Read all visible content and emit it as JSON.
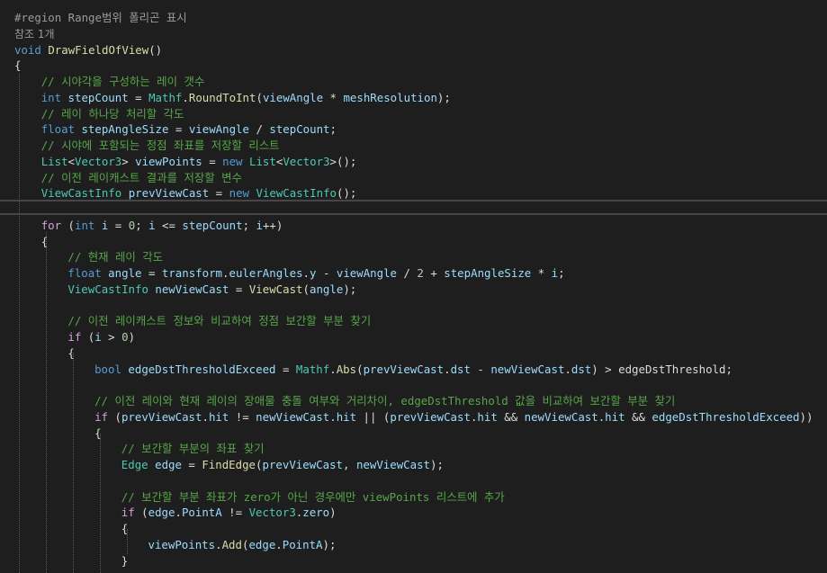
{
  "editor": {
    "theme_colors": {
      "background": "#1e1e1e",
      "keyword": "#569cd6",
      "control_keyword": "#d8a0df",
      "type": "#4ec9b0",
      "method": "#dcdcaa",
      "identifier": "#9cdcfe",
      "comment": "#57a64a",
      "number": "#b5cea8"
    },
    "lines": [
      {
        "tokens": [
          {
            "c": "pp",
            "t": "#region Range범위 폴리곤 표시"
          }
        ]
      },
      {
        "codelens": "참조 1개"
      },
      {
        "tokens": [
          {
            "c": "kw",
            "t": "void"
          },
          {
            "c": "txt",
            "t": " "
          },
          {
            "c": "method",
            "t": "DrawFieldOfView"
          },
          {
            "c": "txt",
            "t": "()"
          }
        ]
      },
      {
        "tokens": [
          {
            "c": "txt",
            "t": "{"
          }
        ]
      },
      {
        "indent": 1,
        "tokens": [
          {
            "c": "cm",
            "t": "// 시야각을 구성하는 레이 갯수"
          }
        ]
      },
      {
        "indent": 1,
        "tokens": [
          {
            "c": "kw",
            "t": "int"
          },
          {
            "c": "txt",
            "t": " "
          },
          {
            "c": "local",
            "t": "stepCount"
          },
          {
            "c": "txt",
            "t": " = "
          },
          {
            "c": "type",
            "t": "Mathf"
          },
          {
            "c": "txt",
            "t": "."
          },
          {
            "c": "method",
            "t": "RoundToInt"
          },
          {
            "c": "txt",
            "t": "("
          },
          {
            "c": "prop",
            "t": "viewAngle"
          },
          {
            "c": "txt",
            "t": " * "
          },
          {
            "c": "prop",
            "t": "meshResolution"
          },
          {
            "c": "txt",
            "t": ");"
          }
        ]
      },
      {
        "indent": 1,
        "tokens": [
          {
            "c": "cm",
            "t": "// 레이 하나당 처리할 각도"
          }
        ]
      },
      {
        "indent": 1,
        "tokens": [
          {
            "c": "kw",
            "t": "float"
          },
          {
            "c": "txt",
            "t": " "
          },
          {
            "c": "local",
            "t": "stepAngleSize"
          },
          {
            "c": "txt",
            "t": " = "
          },
          {
            "c": "prop",
            "t": "viewAngle"
          },
          {
            "c": "txt",
            "t": " / "
          },
          {
            "c": "local",
            "t": "stepCount"
          },
          {
            "c": "txt",
            "t": ";"
          }
        ]
      },
      {
        "indent": 1,
        "tokens": [
          {
            "c": "cm",
            "t": "// 시야에 포함되는 정점 좌표를 저장할 리스트"
          }
        ]
      },
      {
        "indent": 1,
        "tokens": [
          {
            "c": "type",
            "t": "List"
          },
          {
            "c": "txt",
            "t": "<"
          },
          {
            "c": "type",
            "t": "Vector3"
          },
          {
            "c": "txt",
            "t": "> "
          },
          {
            "c": "local",
            "t": "viewPoints"
          },
          {
            "c": "txt",
            "t": " = "
          },
          {
            "c": "kw",
            "t": "new"
          },
          {
            "c": "txt",
            "t": " "
          },
          {
            "c": "type",
            "t": "List"
          },
          {
            "c": "txt",
            "t": "<"
          },
          {
            "c": "type",
            "t": "Vector3"
          },
          {
            "c": "txt",
            "t": ">();"
          }
        ]
      },
      {
        "indent": 1,
        "tokens": [
          {
            "c": "cm",
            "t": "// 이전 레이캐스트 결과를 저장할 변수"
          }
        ]
      },
      {
        "indent": 1,
        "tokens": [
          {
            "c": "type",
            "t": "ViewCastInfo"
          },
          {
            "c": "txt",
            "t": " "
          },
          {
            "c": "local",
            "t": "prevViewCast"
          },
          {
            "c": "txt",
            "t": " = "
          },
          {
            "c": "kw",
            "t": "new"
          },
          {
            "c": "txt",
            "t": " "
          },
          {
            "c": "type",
            "t": "ViewCastInfo"
          },
          {
            "c": "txt",
            "t": "();"
          }
        ]
      },
      {
        "tokens": []
      },
      {
        "indent": 1,
        "tokens": [
          {
            "c": "kw2",
            "t": "for"
          },
          {
            "c": "txt",
            "t": " ("
          },
          {
            "c": "kw",
            "t": "int"
          },
          {
            "c": "txt",
            "t": " "
          },
          {
            "c": "local",
            "t": "i"
          },
          {
            "c": "txt",
            "t": " = "
          },
          {
            "c": "num",
            "t": "0"
          },
          {
            "c": "txt",
            "t": "; "
          },
          {
            "c": "local",
            "t": "i"
          },
          {
            "c": "txt",
            "t": " <= "
          },
          {
            "c": "local",
            "t": "stepCount"
          },
          {
            "c": "txt",
            "t": "; "
          },
          {
            "c": "local",
            "t": "i"
          },
          {
            "c": "txt",
            "t": "++)"
          }
        ]
      },
      {
        "indent": 1,
        "tokens": [
          {
            "c": "txt",
            "t": "{"
          }
        ]
      },
      {
        "indent": 2,
        "tokens": [
          {
            "c": "cm",
            "t": "// 현재 레이 각도"
          }
        ]
      },
      {
        "indent": 2,
        "tokens": [
          {
            "c": "kw",
            "t": "float"
          },
          {
            "c": "txt",
            "t": " "
          },
          {
            "c": "local",
            "t": "angle"
          },
          {
            "c": "txt",
            "t": " = "
          },
          {
            "c": "prop",
            "t": "transform"
          },
          {
            "c": "txt",
            "t": "."
          },
          {
            "c": "prop",
            "t": "eulerAngles"
          },
          {
            "c": "txt",
            "t": "."
          },
          {
            "c": "prop",
            "t": "y"
          },
          {
            "c": "txt",
            "t": " - "
          },
          {
            "c": "prop",
            "t": "viewAngle"
          },
          {
            "c": "txt",
            "t": " / "
          },
          {
            "c": "num",
            "t": "2"
          },
          {
            "c": "txt",
            "t": " + "
          },
          {
            "c": "local",
            "t": "stepAngleSize"
          },
          {
            "c": "txt",
            "t": " * "
          },
          {
            "c": "local",
            "t": "i"
          },
          {
            "c": "txt",
            "t": ";"
          }
        ]
      },
      {
        "indent": 2,
        "tokens": [
          {
            "c": "type",
            "t": "ViewCastInfo"
          },
          {
            "c": "txt",
            "t": " "
          },
          {
            "c": "local",
            "t": "newViewCast"
          },
          {
            "c": "txt",
            "t": " = "
          },
          {
            "c": "method",
            "t": "ViewCast"
          },
          {
            "c": "txt",
            "t": "("
          },
          {
            "c": "local",
            "t": "angle"
          },
          {
            "c": "txt",
            "t": ");"
          }
        ]
      },
      {
        "tokens": []
      },
      {
        "indent": 2,
        "tokens": [
          {
            "c": "cm",
            "t": "// 이전 레이캐스트 정보와 비교하여 정점 보간할 부분 찾기"
          }
        ]
      },
      {
        "indent": 2,
        "tokens": [
          {
            "c": "kw2",
            "t": "if"
          },
          {
            "c": "txt",
            "t": " ("
          },
          {
            "c": "local",
            "t": "i"
          },
          {
            "c": "txt",
            "t": " > "
          },
          {
            "c": "num",
            "t": "0"
          },
          {
            "c": "txt",
            "t": ")"
          }
        ]
      },
      {
        "indent": 2,
        "tokens": [
          {
            "c": "txt",
            "t": "{"
          }
        ]
      },
      {
        "indent": 3,
        "tokens": [
          {
            "c": "kw",
            "t": "bool"
          },
          {
            "c": "txt",
            "t": " "
          },
          {
            "c": "local",
            "t": "edgeDstThresholdExceed"
          },
          {
            "c": "txt",
            "t": " = "
          },
          {
            "c": "type",
            "t": "Mathf"
          },
          {
            "c": "txt",
            "t": "."
          },
          {
            "c": "method",
            "t": "Abs"
          },
          {
            "c": "txt",
            "t": "("
          },
          {
            "c": "local",
            "t": "prevViewCast"
          },
          {
            "c": "txt",
            "t": "."
          },
          {
            "c": "prop",
            "t": "dst"
          },
          {
            "c": "txt",
            "t": " - "
          },
          {
            "c": "local",
            "t": "newViewCast"
          },
          {
            "c": "txt",
            "t": "."
          },
          {
            "c": "prop",
            "t": "dst"
          },
          {
            "c": "txt",
            "t": ") > "
          },
          {
            "c": "txt",
            "t": "edgeDstThreshold"
          },
          {
            "c": "txt",
            "t": ";"
          }
        ]
      },
      {
        "tokens": []
      },
      {
        "indent": 3,
        "tokens": [
          {
            "c": "cm",
            "t": "// 이전 레이와 현재 레이의 장애물 충돌 여부와 거리차이, edgeDstThreshold 값을 비교하여 보간할 부분 찾기"
          }
        ]
      },
      {
        "indent": 3,
        "tokens": [
          {
            "c": "kw2",
            "t": "if"
          },
          {
            "c": "txt",
            "t": " ("
          },
          {
            "c": "local",
            "t": "prevViewCast"
          },
          {
            "c": "txt",
            "t": "."
          },
          {
            "c": "prop",
            "t": "hit"
          },
          {
            "c": "txt",
            "t": " != "
          },
          {
            "c": "local",
            "t": "newViewCast"
          },
          {
            "c": "txt",
            "t": "."
          },
          {
            "c": "prop",
            "t": "hit"
          },
          {
            "c": "txt",
            "t": " || ("
          },
          {
            "c": "local",
            "t": "prevViewCast"
          },
          {
            "c": "txt",
            "t": "."
          },
          {
            "c": "prop",
            "t": "hit"
          },
          {
            "c": "txt",
            "t": " && "
          },
          {
            "c": "local",
            "t": "newViewCast"
          },
          {
            "c": "txt",
            "t": "."
          },
          {
            "c": "prop",
            "t": "hit"
          },
          {
            "c": "txt",
            "t": " && "
          },
          {
            "c": "local",
            "t": "edgeDstThresholdExceed"
          },
          {
            "c": "txt",
            "t": "))"
          }
        ]
      },
      {
        "indent": 3,
        "tokens": [
          {
            "c": "txt",
            "t": "{"
          }
        ]
      },
      {
        "indent": 4,
        "tokens": [
          {
            "c": "cm",
            "t": "// 보간할 부분의 좌표 찾기"
          }
        ]
      },
      {
        "indent": 4,
        "tokens": [
          {
            "c": "type",
            "t": "Edge"
          },
          {
            "c": "txt",
            "t": " "
          },
          {
            "c": "local",
            "t": "edge"
          },
          {
            "c": "txt",
            "t": " = "
          },
          {
            "c": "method",
            "t": "FindEdge"
          },
          {
            "c": "txt",
            "t": "("
          },
          {
            "c": "local",
            "t": "prevViewCast"
          },
          {
            "c": "txt",
            "t": ", "
          },
          {
            "c": "local",
            "t": "newViewCast"
          },
          {
            "c": "txt",
            "t": ");"
          }
        ]
      },
      {
        "tokens": []
      },
      {
        "indent": 4,
        "tokens": [
          {
            "c": "cm",
            "t": "// 보간할 부분 좌표가 zero가 아닌 경우에만 viewPoints 리스트에 추가"
          }
        ]
      },
      {
        "indent": 4,
        "tokens": [
          {
            "c": "kw2",
            "t": "if"
          },
          {
            "c": "txt",
            "t": " ("
          },
          {
            "c": "local",
            "t": "edge"
          },
          {
            "c": "txt",
            "t": "."
          },
          {
            "c": "prop",
            "t": "PointA"
          },
          {
            "c": "txt",
            "t": " != "
          },
          {
            "c": "type",
            "t": "Vector3"
          },
          {
            "c": "txt",
            "t": "."
          },
          {
            "c": "prop",
            "t": "zero"
          },
          {
            "c": "txt",
            "t": ")"
          }
        ]
      },
      {
        "indent": 4,
        "tokens": [
          {
            "c": "txt",
            "t": "{"
          }
        ]
      },
      {
        "indent": 5,
        "tokens": [
          {
            "c": "local",
            "t": "viewPoints"
          },
          {
            "c": "txt",
            "t": "."
          },
          {
            "c": "method",
            "t": "Add"
          },
          {
            "c": "txt",
            "t": "("
          },
          {
            "c": "local",
            "t": "edge"
          },
          {
            "c": "txt",
            "t": "."
          },
          {
            "c": "prop",
            "t": "PointA"
          },
          {
            "c": "txt",
            "t": ");"
          }
        ]
      },
      {
        "indent": 4,
        "tokens": [
          {
            "c": "txt",
            "t": "}"
          }
        ]
      }
    ]
  }
}
